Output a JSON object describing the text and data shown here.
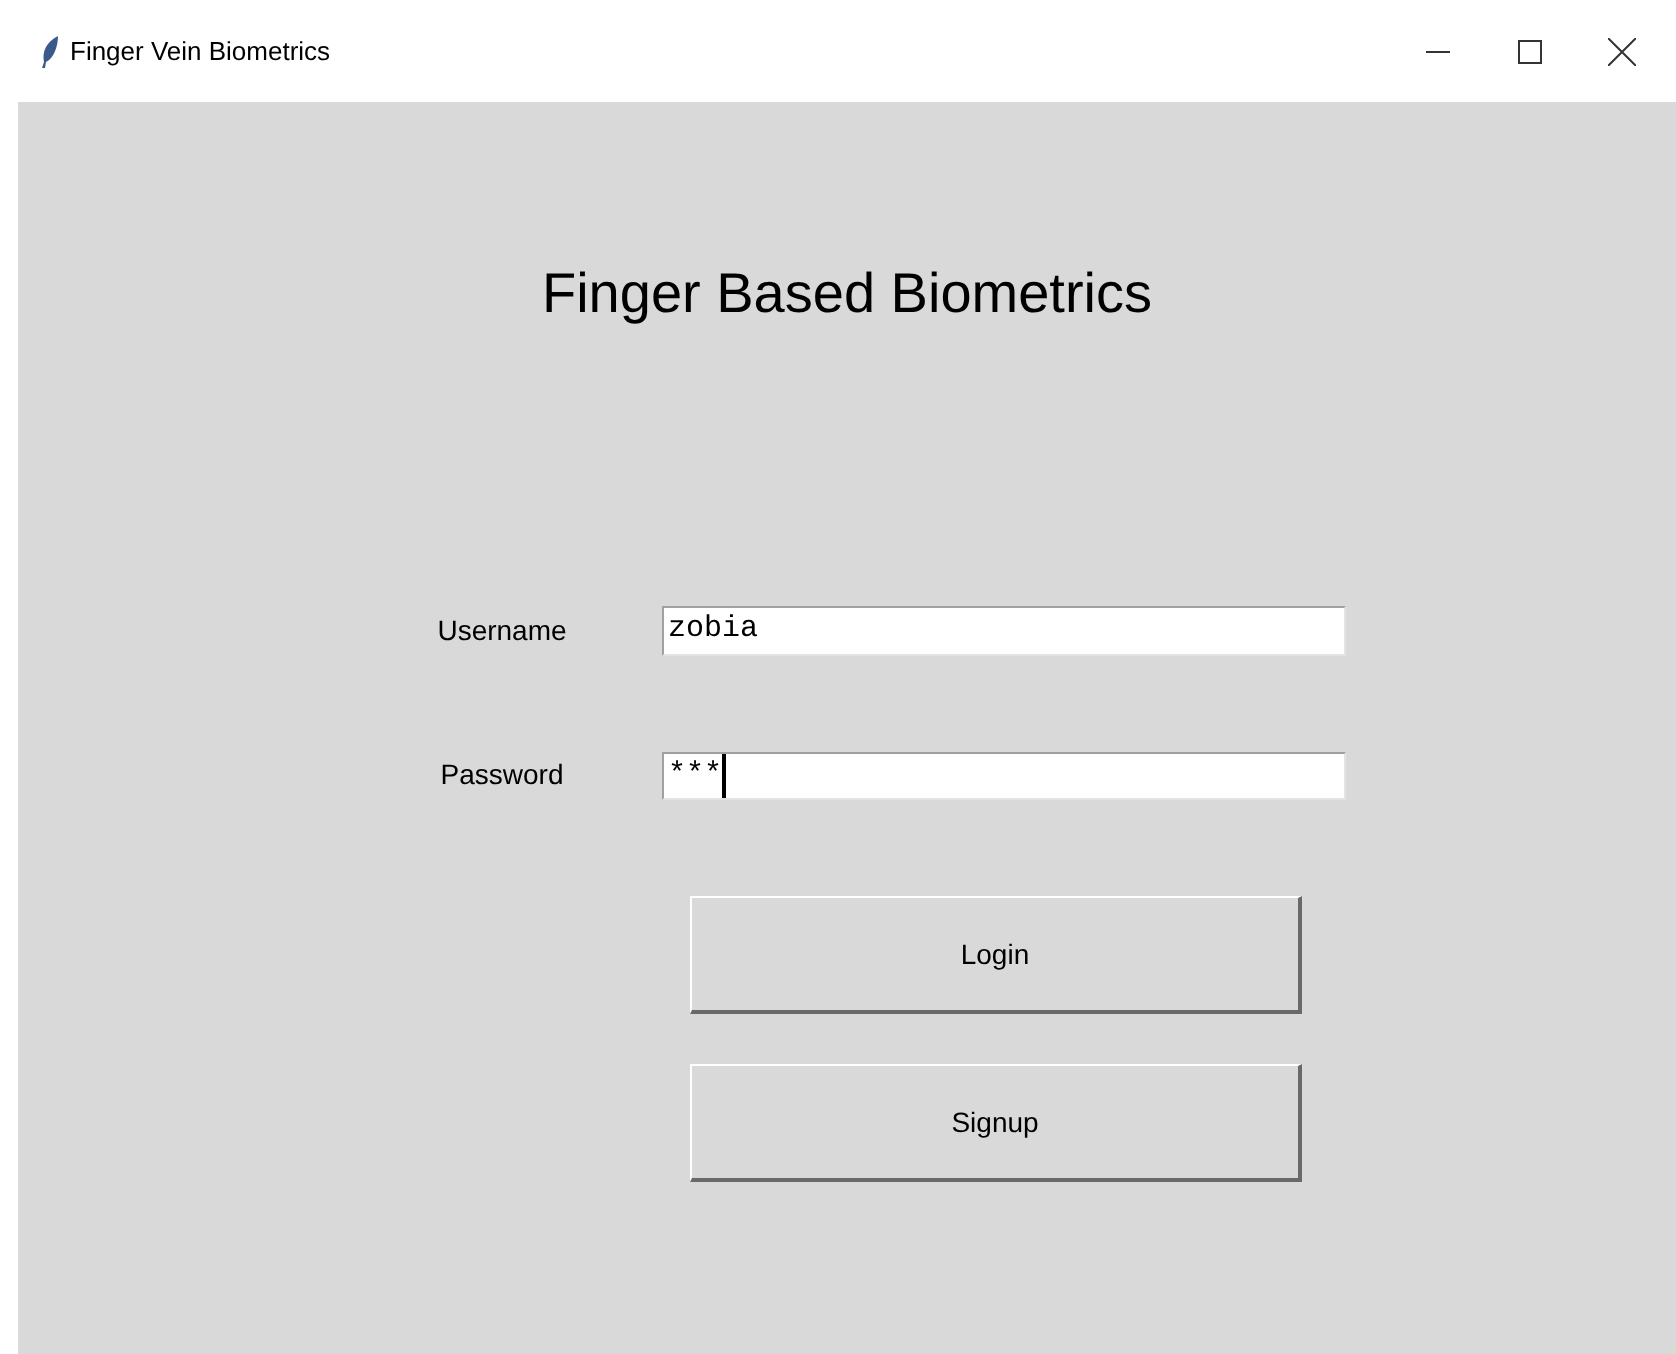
{
  "window": {
    "title": "Finger Vein Biometrics"
  },
  "heading": "Finger Based Biometrics",
  "fields": [
    {
      "label": "Username",
      "value": "zobia",
      "focused": false
    },
    {
      "label": "Password",
      "value": "***",
      "focused": true
    }
  ],
  "buttons": [
    "Login",
    "Signup"
  ]
}
